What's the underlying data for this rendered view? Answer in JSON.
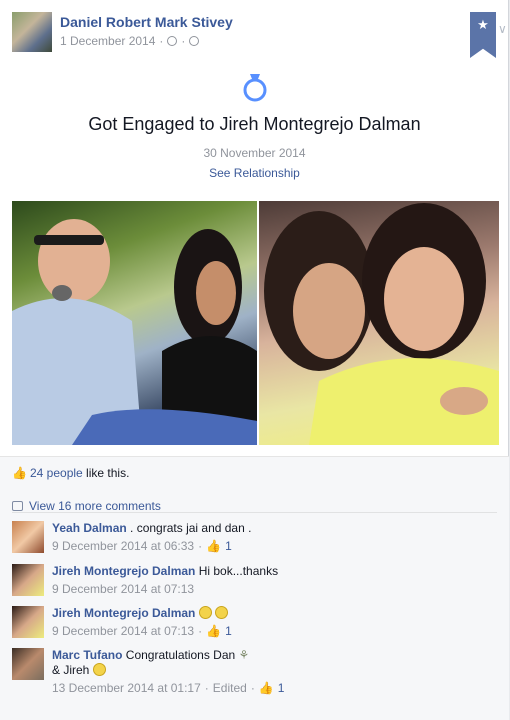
{
  "post": {
    "author": "Daniel Robert Mark Stivey",
    "date": "1 December 2014",
    "meta_sep": "·",
    "ribbon_star": "★",
    "chevron": "∨"
  },
  "life_event": {
    "icon": "ring-icon",
    "title": "Got Engaged to Jireh Montegrejo Dalman",
    "date": "30 November 2014",
    "link": "See Relationship"
  },
  "likes": {
    "count_link": "24 people",
    "suffix": " like this."
  },
  "comments": {
    "view_more": "View 16 more comments",
    "items": [
      {
        "name": "Yeah Dalman",
        "text": " . congrats jai and dan .",
        "time": "9 December 2014 at 06:33",
        "likes": "1"
      },
      {
        "name": "Jireh Montegrejo Dalman",
        "text": " Hi bok...thanks",
        "time": "9 December 2014 at 07:13",
        "likes": ""
      },
      {
        "name": "Jireh Montegrejo Dalman",
        "text": "",
        "time": "9 December 2014 at 07:13",
        "likes": "1"
      },
      {
        "name": "Marc Tufano",
        "text": " Congratulations Dan",
        "text2": "& Jireh",
        "time": "13 December 2014 at 01:17",
        "edited": "Edited",
        "likes": "1"
      }
    ]
  },
  "colors": {
    "link": "#3b5998",
    "meta": "#90949c",
    "ribbon": "#5b74a8",
    "like_blue": "#5890ff"
  }
}
